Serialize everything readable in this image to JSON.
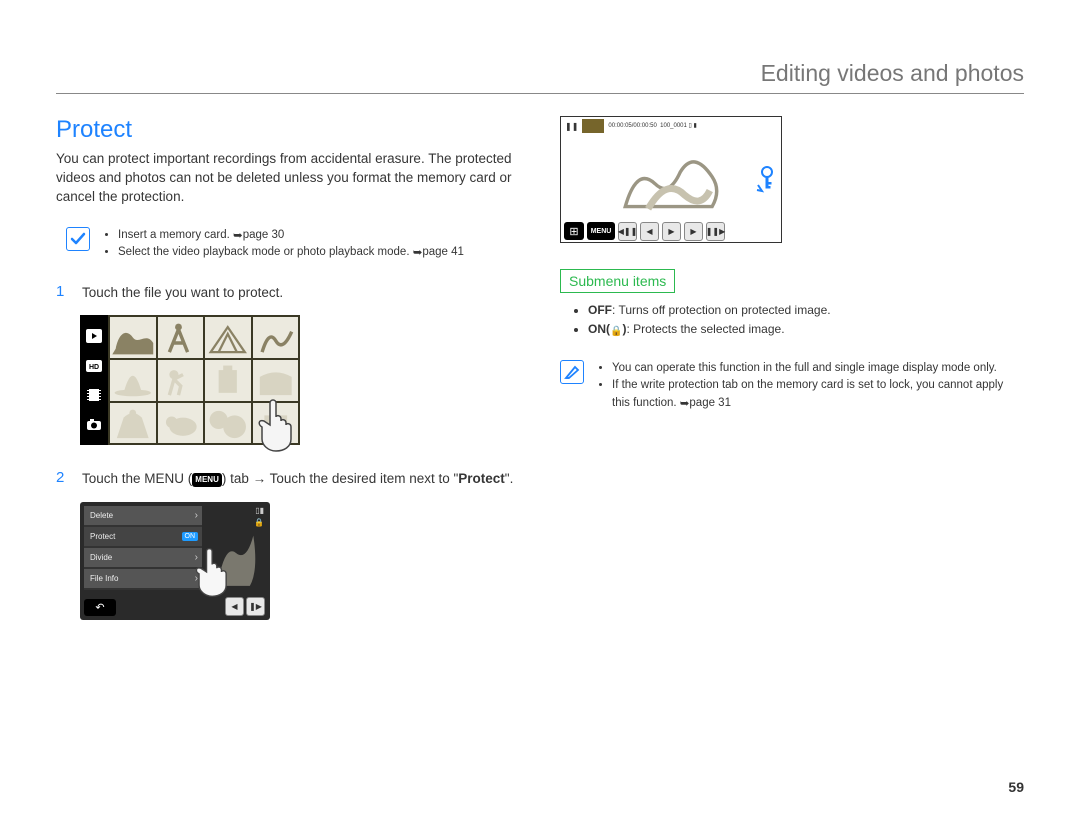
{
  "page_number": "59",
  "chapter_title": "Editing videos and photos",
  "section_title": "Protect",
  "intro_text": "You can protect important recordings from accidental erasure. The protected videos and photos can not be deleted unless you format the memory card or cancel the protection.",
  "precheck": {
    "item1": "Insert a memory card. ",
    "item1_ref": "page 30",
    "item2": "Select the video playback mode or photo playback mode. ",
    "item2_ref": "page 41"
  },
  "steps": {
    "s1_num": "1",
    "s1_text": "Touch the file you want to protect.",
    "s2_num": "2",
    "s2_pre": "Touch the MENU (",
    "s2_menu": "MENU",
    "s2_mid": ") tab → Touch the desired item next to \"",
    "s2_bold": "Protect",
    "s2_post": "\"."
  },
  "menu_screen": {
    "items": [
      "Delete",
      "Protect",
      "Divide",
      "File Info"
    ],
    "on_label": "ON"
  },
  "playback_screen": {
    "timecode": "00:00:05/00:00:50",
    "counter": "100_0001",
    "menu_label": "MENU"
  },
  "submenu": {
    "heading": "Submenu items",
    "off_label": "OFF",
    "off_desc": ": Turns off protection on protected image.",
    "on_label": "ON(",
    "on_desc": "): Protects the selected image."
  },
  "bottom_note": {
    "line1": "You can operate this function in the full and single image display mode only.",
    "line2a": "If the write protection tab on the memory card is set to lock, you cannot apply this function. ",
    "line2_ref": "page 31"
  }
}
